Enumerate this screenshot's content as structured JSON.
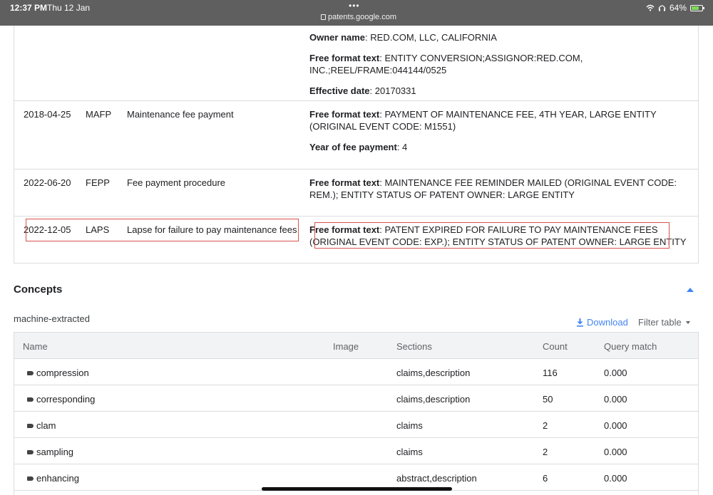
{
  "statusbar": {
    "time": "12:37 PM",
    "date": "Thu 12 Jan",
    "dots": "•••",
    "url": "patents.google.com",
    "battery": "64%"
  },
  "events": {
    "top_fields": [
      {
        "label": "Owner name",
        "value": ": RED.COM, LLC, CALIFORNIA"
      },
      {
        "label": "Free format text",
        "value": ": ENTITY CONVERSION;ASSIGNOR:RED.COM, INC.;REEL/FRAME:044144/0525"
      },
      {
        "label": "Effective date",
        "value": ": 20170331"
      }
    ],
    "rows": [
      {
        "date": "2018-04-25",
        "code": "MAFP",
        "title": "Maintenance fee payment",
        "f1_label": "Free format text",
        "f1_value": ": PAYMENT OF MAINTENANCE FEE, 4TH YEAR, LARGE ENTITY (ORIGINAL EVENT CODE: M1551)",
        "f2_label": "Year of fee payment",
        "f2_value": ": 4"
      },
      {
        "date": "2022-06-20",
        "code": "FEPP",
        "title": "Fee payment procedure",
        "f1_label": "Free format text",
        "f1_value": ": MAINTENANCE FEE REMINDER MAILED (ORIGINAL EVENT CODE: REM.); ENTITY STATUS OF PATENT OWNER: LARGE ENTITY"
      },
      {
        "date": "2022-12-05",
        "code": "LAPS",
        "title": "Lapse for failure to pay maintenance fees",
        "f1_label": "Free format text",
        "f1_value": ": PATENT EXPIRED FOR FAILURE TO PAY MAINTENANCE FEES (ORIGINAL EVENT CODE: EXP.); ENTITY STATUS OF PATENT OWNER: LARGE ENTITY"
      }
    ]
  },
  "concepts": {
    "title": "Concepts",
    "subtitle": "machine-extracted",
    "download": "Download",
    "filter": "Filter table",
    "columns": [
      "Name",
      "Image",
      "Sections",
      "Count",
      "Query match"
    ],
    "rows": [
      {
        "name": "compression",
        "sections": "claims,description",
        "count": "116",
        "match": "0.000"
      },
      {
        "name": "corresponding",
        "sections": "claims,description",
        "count": "50",
        "match": "0.000"
      },
      {
        "name": "clam",
        "sections": "claims",
        "count": "2",
        "match": "0.000"
      },
      {
        "name": "sampling",
        "sections": "claims",
        "count": "2",
        "match": "0.000"
      },
      {
        "name": "enhancing",
        "sections": "abstract,description",
        "count": "6",
        "match": "0.000"
      }
    ]
  },
  "colors": {
    "accent": "#4285f4",
    "highlight_box": "#d9534f"
  }
}
